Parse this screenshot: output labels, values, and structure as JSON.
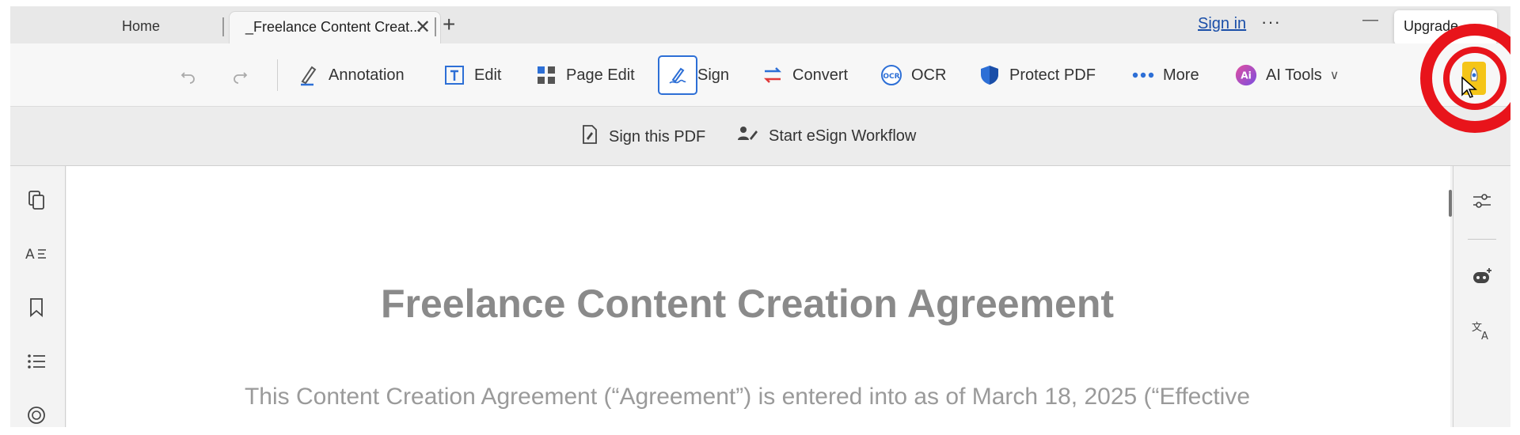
{
  "tabs": {
    "home_label": "Home",
    "active_label": "_Freelance Content Creat...",
    "close_glyph": "✕",
    "add_glyph": "+"
  },
  "header": {
    "signin_label": "Sign in",
    "more_glyph": "···",
    "minimize_glyph": "—",
    "upgrade_label": "Upgrade"
  },
  "toolbar": {
    "undo_icon": "undo-icon",
    "redo_icon": "redo-icon",
    "items": [
      {
        "label": "Annotation",
        "icon": "pen-icon"
      },
      {
        "label": "Edit",
        "icon": "text-edit-icon"
      },
      {
        "label": "Page Edit",
        "icon": "grid-icon"
      },
      {
        "label": "Sign",
        "icon": "sign-pen-icon"
      },
      {
        "label": "Convert",
        "icon": "convert-icon"
      },
      {
        "label": "OCR",
        "icon": "ocr-icon"
      },
      {
        "label": "Protect PDF",
        "icon": "shield-icon"
      },
      {
        "label": "More",
        "icon": "more-dots-icon"
      },
      {
        "label": "AI Tools",
        "icon": "ai-icon",
        "caret": "∨"
      }
    ],
    "accent": "#2d6fd6"
  },
  "subbar": {
    "sign_pdf_label": "Sign this PDF",
    "esign_label": "Start eSign Workflow"
  },
  "document": {
    "title": "Freelance Content Creation Agreement",
    "paragraph": "This Content Creation Agreement (“Agreement”) is entered into as of March 18, 2025 (“Effective"
  },
  "highlight_color": "#e8141b"
}
